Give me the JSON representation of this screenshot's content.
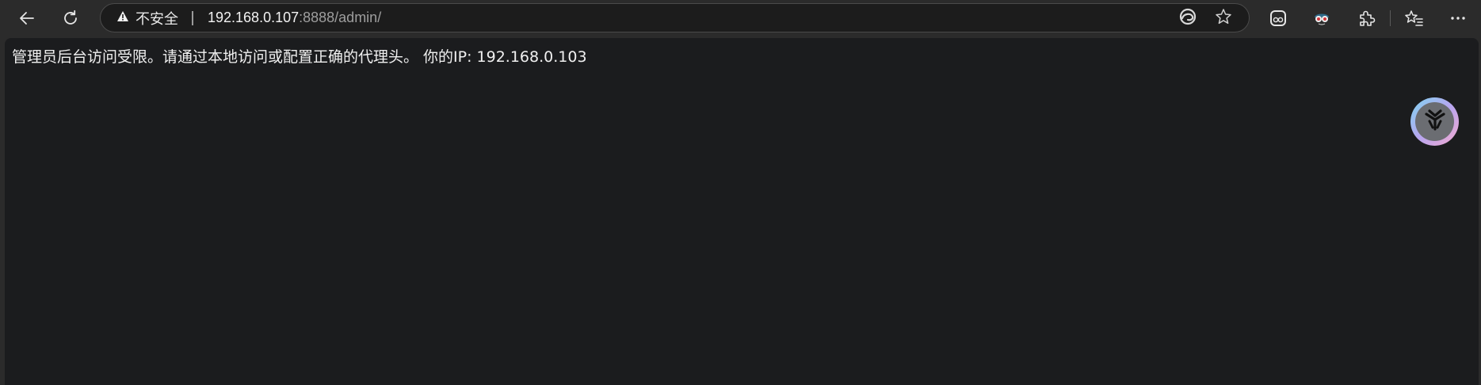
{
  "browser": {
    "security_label": "不安全",
    "url_host": "192.168.0.107",
    "url_rest": ":8888/admin/",
    "icons": {
      "back": "back-arrow-icon",
      "refresh": "refresh-icon",
      "warning": "warning-icon",
      "edge": "edge-logo-icon",
      "favorite": "star-icon",
      "ext1": "face-extension-icon",
      "ext2": "goggles-extension-icon",
      "extensions": "puzzle-icon",
      "favorites": "favorites-list-icon",
      "more": "more-dots-icon"
    }
  },
  "page": {
    "message": "管理员后台访问受限。请通过本地访问或配置正确的代理头。 你的IP: 192.168.0.103"
  },
  "floating_button": {
    "icon": "y-logo-icon",
    "colors": {
      "ring_start": "#7fd4f0",
      "ring_end": "#f3a9cf",
      "fill": "#6b6d72"
    }
  },
  "colors": {
    "toolbar_bg": "#2b2b2b",
    "page_bg": "#1b1c1e",
    "text": "#f0f0f0",
    "url_dim": "#9e9e9e"
  }
}
